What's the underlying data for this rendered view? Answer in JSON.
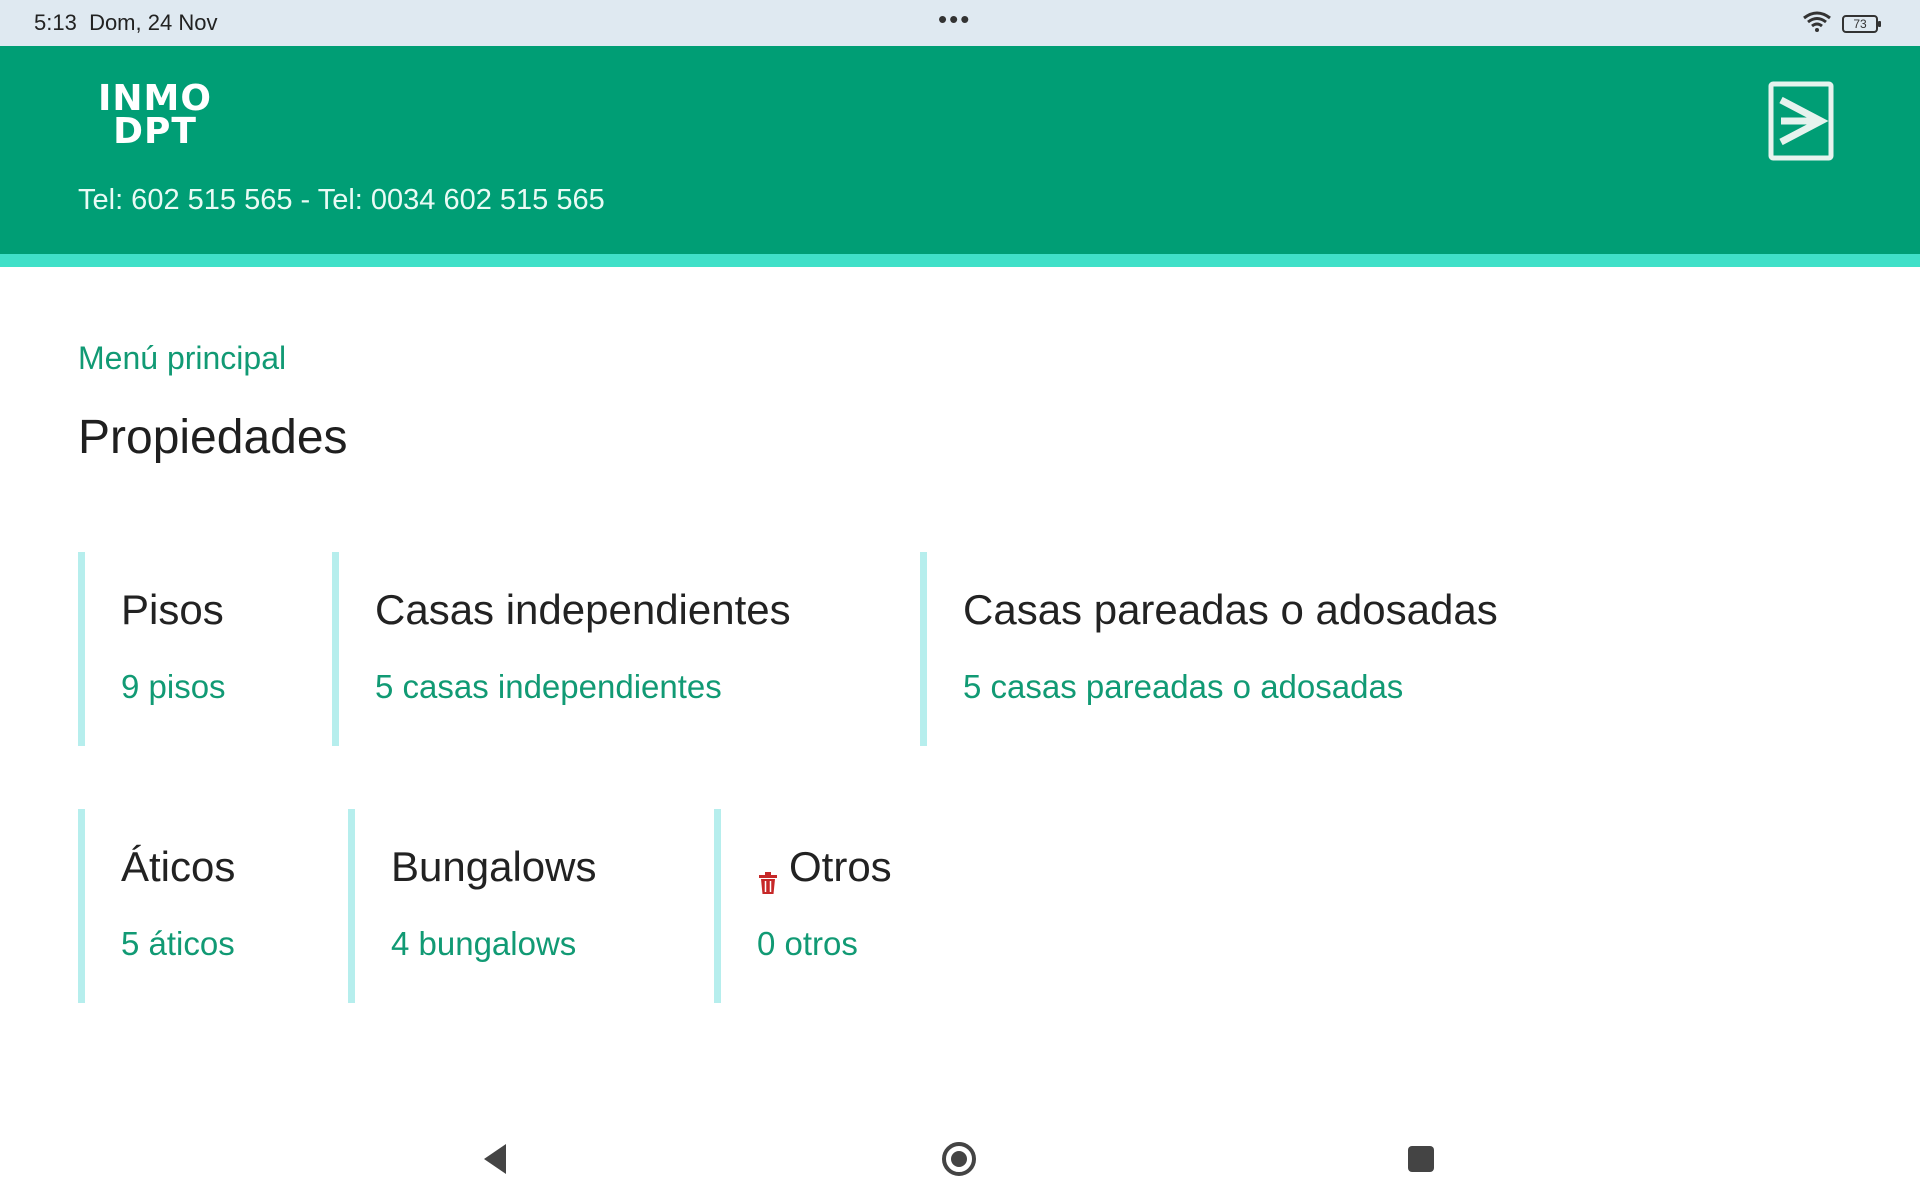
{
  "status_bar": {
    "time": "5:13",
    "date": "Dom, 24 Nov",
    "dots": "•••",
    "battery": "73",
    "icons": [
      "wifi-icon",
      "battery-icon"
    ]
  },
  "header": {
    "logo_line1": "INMO",
    "logo_line2": "DPT",
    "phone": "Tel: 602 515 565 - Tel: 0034 602 515 565",
    "logout_icon": "logout-icon",
    "color": "#009e75",
    "stripe_color": "#40e0c8"
  },
  "main": {
    "breadcrumb": "Menú principal",
    "title": "Propiedades",
    "accent_color": "#119a74",
    "cards": [
      {
        "title": "Pisos",
        "count": "9 pisos"
      },
      {
        "title": "Casas independientes",
        "count": "5 casas independientes"
      },
      {
        "title": "Casas pareadas o adosadas",
        "count": "5 casas pareadas o adosadas"
      },
      {
        "title": "Áticos",
        "count": "5 áticos"
      },
      {
        "title": "Bungalows",
        "count": "4 bungalows"
      },
      {
        "title": "Otros",
        "count": "0 otros",
        "icon": "trash-icon"
      }
    ]
  },
  "nav_bar": {
    "icons": [
      "back-icon",
      "home-icon",
      "recents-icon"
    ]
  }
}
